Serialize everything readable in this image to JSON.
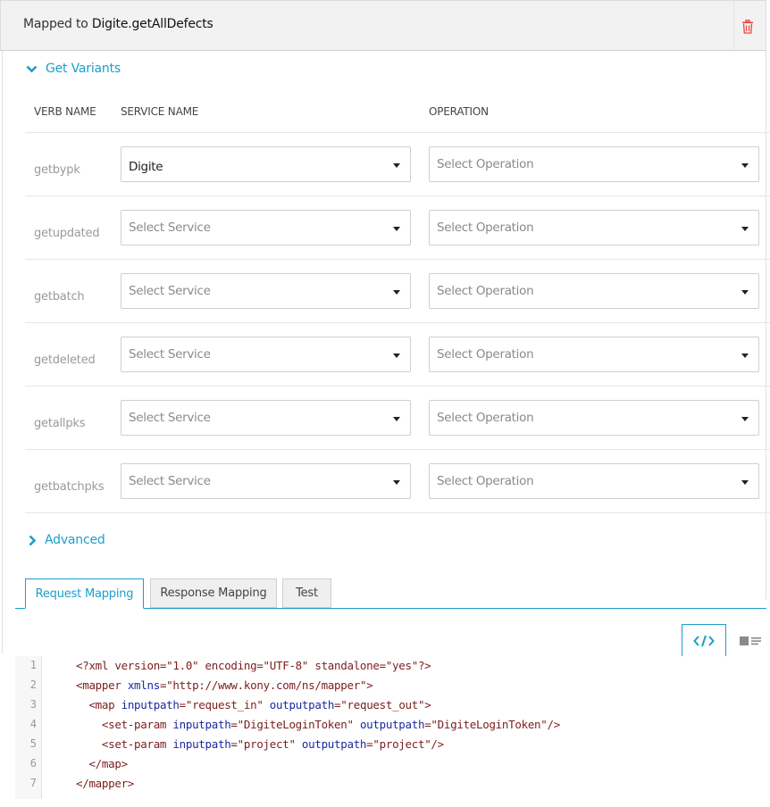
{
  "header": {
    "mapped_prefix": "Mapped to ",
    "mapped_target": "Digite.getAllDefects",
    "delete_color": "#e8453c"
  },
  "variants": {
    "title": "Get Variants",
    "columns": {
      "verb": "VERB NAME",
      "service": "SERVICE NAME",
      "operation": "OPERATION"
    },
    "rows": [
      {
        "verb": "getbypk",
        "service": "Digite",
        "operation": "Select Operation"
      },
      {
        "verb": "getupdated",
        "service": "Select Service",
        "operation": "Select Operation"
      },
      {
        "verb": "getbatch",
        "service": "Select Service",
        "operation": "Select Operation"
      },
      {
        "verb": "getdeleted",
        "service": "Select Service",
        "operation": "Select Operation"
      },
      {
        "verb": "getallpks",
        "service": "Select Service",
        "operation": "Select Operation"
      },
      {
        "verb": "getbatchpks",
        "service": "Select Service",
        "operation": "Select Operation"
      }
    ]
  },
  "advanced": {
    "title": "Advanced"
  },
  "tabs": [
    {
      "label": "Request Mapping",
      "active": true
    },
    {
      "label": "Response Mapping",
      "active": false
    },
    {
      "label": "Test",
      "active": false
    }
  ],
  "accent_color": "#1b9fca",
  "editor": {
    "lines": [
      {
        "n": "1",
        "html": "&lt;?xml version=\"1.0\" encoding=\"UTF-8\" standalone=\"yes\"?&gt;"
      },
      {
        "n": "2",
        "html": "&lt;mapper <span class='attr'>xmlns</span>=\"http://www.kony.com/ns/mapper\"&gt;"
      },
      {
        "n": "3",
        "html": "  &lt;map <span class='attr'>inputpath</span>=\"request_in\" <span class='attr'>outputpath</span>=\"request_out\"&gt;"
      },
      {
        "n": "4",
        "html": "    &lt;set-param <span class='attr'>inputpath</span>=\"DigiteLoginToken\" <span class='attr'>outputpath</span>=\"DigiteLoginToken\"/&gt;"
      },
      {
        "n": "5",
        "html": "    &lt;set-param <span class='attr'>inputpath</span>=\"project\" <span class='attr'>outputpath</span>=\"project\"/&gt;"
      },
      {
        "n": "6",
        "html": "  &lt;/map&gt;"
      },
      {
        "n": "7",
        "html": "&lt;/mapper&gt;"
      }
    ]
  }
}
